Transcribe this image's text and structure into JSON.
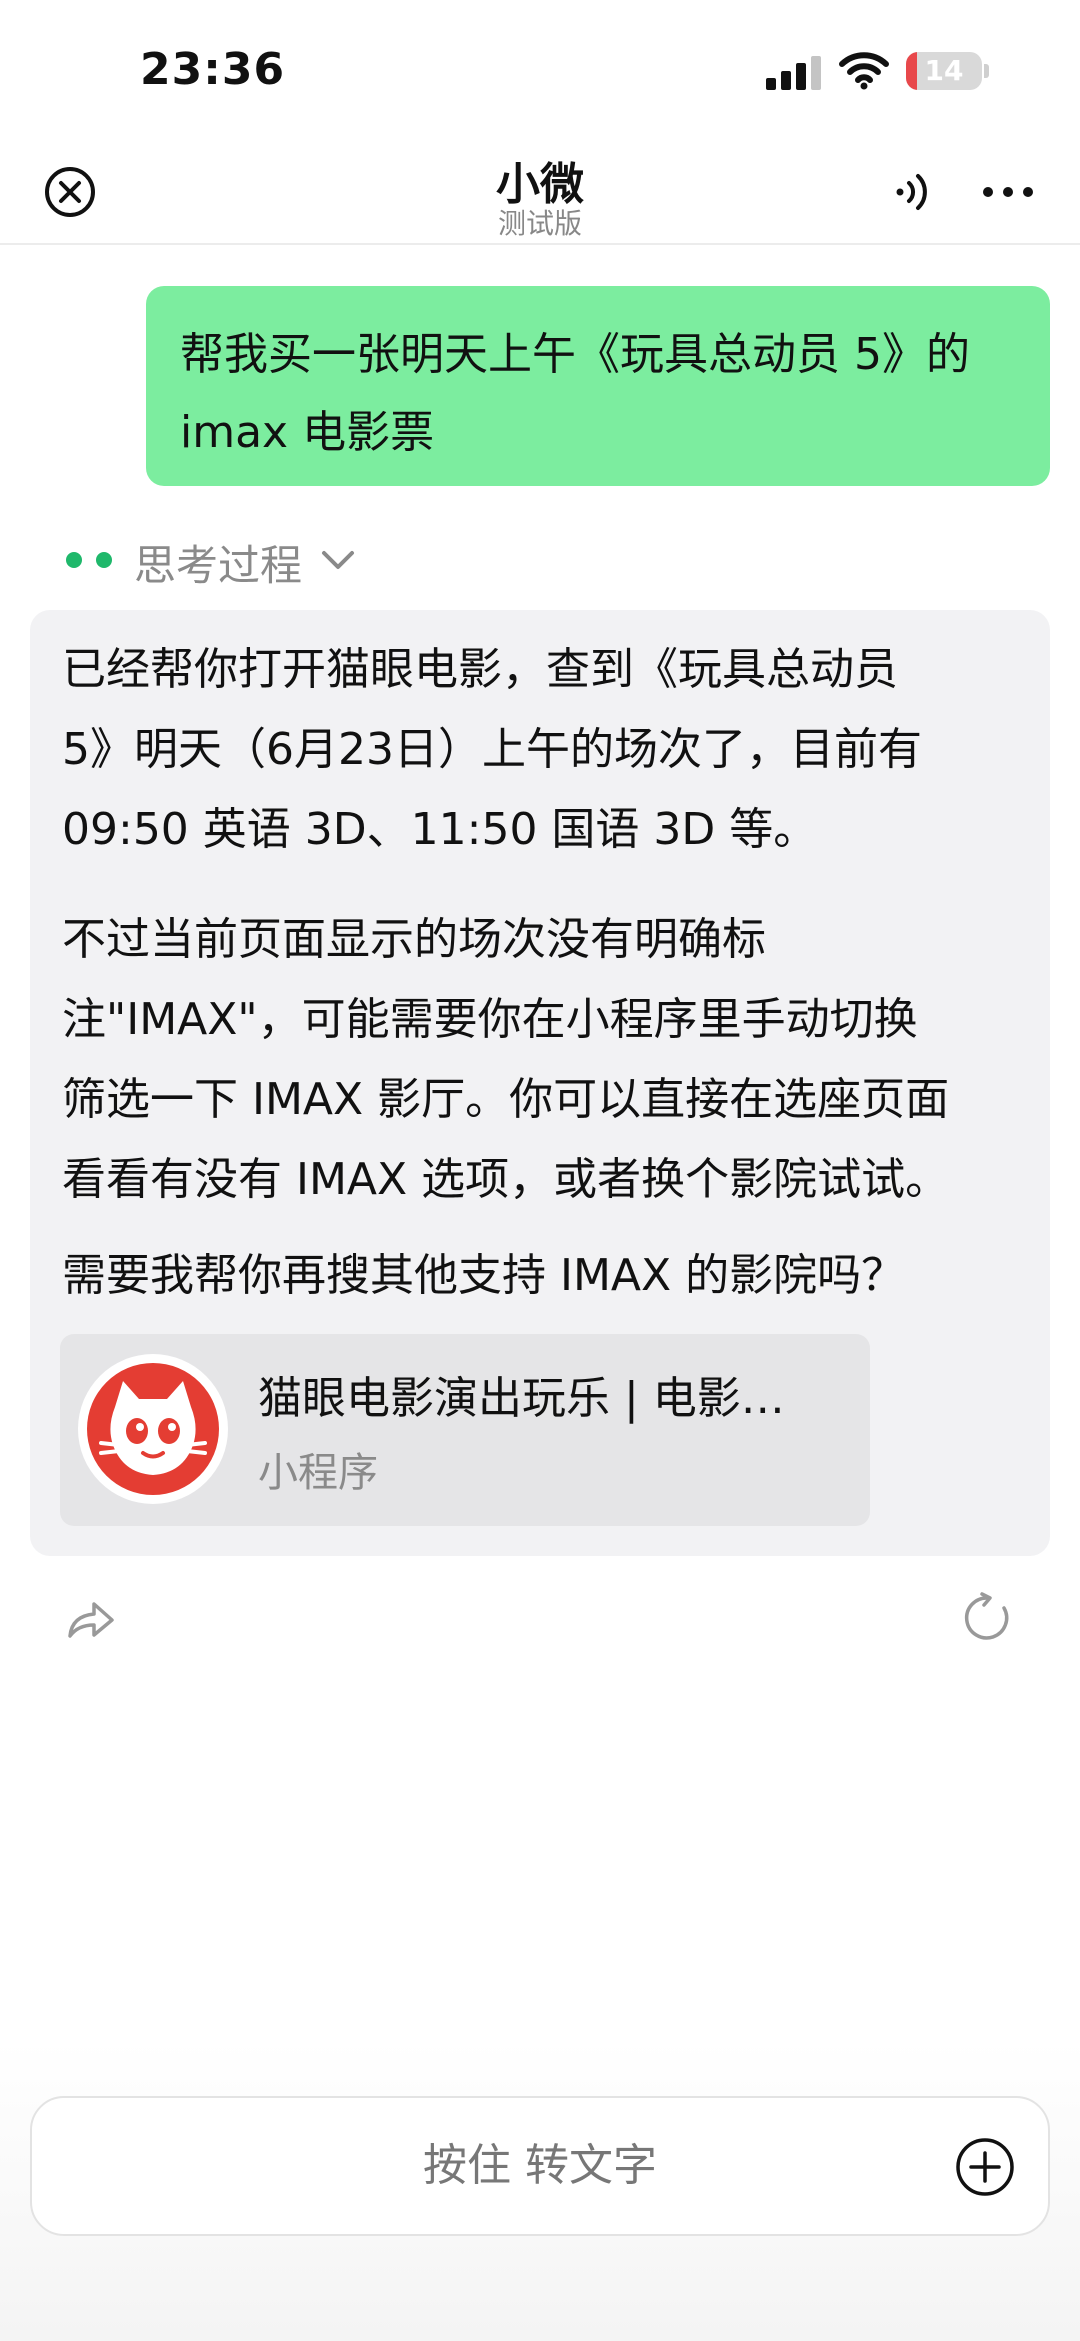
{
  "status_bar": {
    "time": "23:36",
    "battery_level": "14",
    "battery_fraction": 0.14,
    "icons": [
      "cellular-signal-icon",
      "wifi-icon",
      "battery-charging-icon"
    ]
  },
  "nav": {
    "title": "小微",
    "subtitle": "测试版",
    "icons": [
      "close-icon",
      "voice-icon",
      "more-icon"
    ]
  },
  "user_message": {
    "line1": "帮我买一张明天上午《玩具总动员 5》的",
    "line2": "imax 电影票"
  },
  "thinking": {
    "label": "思考过程",
    "icon": "chevron-down-icon"
  },
  "assistant_message": {
    "paragraphs": [
      [
        "已经帮你打开猫眼电影，查到《玩具总动员",
        "5》明天（6月23日）上午的场次了，目前有",
        "09:50 英语 3D、11:50 国语 3D 等。"
      ],
      [
        "不过当前页面显示的场次没有明确标",
        "注\"IMAX\"，可能需要你在小程序里手动切换",
        "筛选一下 IMAX 影厅。你可以直接在选座页面",
        "看看有没有 IMAX 选项，或者换个影院试试。"
      ],
      [
        "需要我帮你再搜其他支持 IMAX 的影院吗？"
      ]
    ],
    "mini_program": {
      "title": "猫眼电影演出玩乐 | 电影…",
      "type": "小程序",
      "logo_icon": "maoyan-cat-logo-icon",
      "brand_color": "#e43d33"
    }
  },
  "actions": {
    "icons": [
      "share-icon",
      "refresh-icon"
    ]
  },
  "input": {
    "label": "按住 转文字",
    "icon": "plus-circle-icon"
  },
  "colors": {
    "user_bubble": "#7ced9f",
    "assistant_card": "#f2f2f4",
    "thinking_dots": "#1fb86b",
    "battery_low": "#e8484b"
  }
}
